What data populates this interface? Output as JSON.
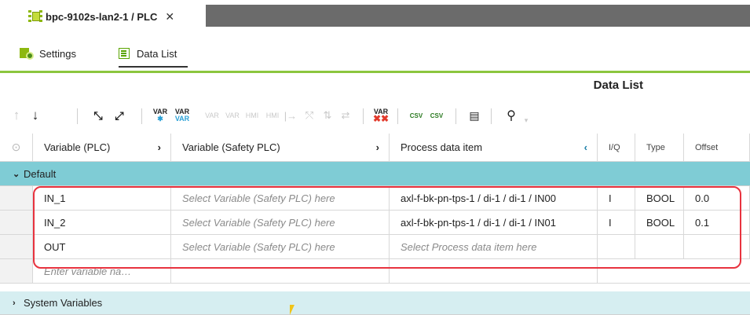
{
  "tab": {
    "title": "bpc-9102s-lan2-1 / PLC",
    "close_icon": "close-icon"
  },
  "subtabs": [
    {
      "label": "Settings",
      "icon": "settings-icon"
    },
    {
      "label": "Data List",
      "icon": "list-icon"
    }
  ],
  "panel_title": "Data List",
  "toolbar": {
    "buttons": [
      {
        "name": "move-up-icon",
        "glyph": "↑",
        "enabled": false
      },
      {
        "name": "move-down-icon",
        "glyph": "↓",
        "enabled": true
      },
      {
        "name": "collapse-all-icon",
        "glyph": "⤡",
        "enabled": true
      },
      {
        "name": "expand-all-icon",
        "glyph": "⤢",
        "enabled": true
      },
      {
        "name": "add-var-icon",
        "glyph": "VAR",
        "enabled": true
      },
      {
        "name": "add-var-group-icon",
        "glyph": "VAR",
        "enabled": true
      },
      {
        "name": "edit-var-icon",
        "glyph": "VAR",
        "enabled": false
      },
      {
        "name": "delete-var-icon",
        "glyph": "VAR",
        "enabled": false
      },
      {
        "name": "hmi-icon",
        "glyph": "HMI",
        "enabled": false
      },
      {
        "name": "hmi-delete-icon",
        "glyph": "HMI",
        "enabled": false
      },
      {
        "name": "link-icon",
        "glyph": "|→",
        "enabled": false
      },
      {
        "name": "unlink-icon",
        "glyph": "⤲",
        "enabled": false
      },
      {
        "name": "map-icon",
        "glyph": "⇅",
        "enabled": false
      },
      {
        "name": "swap-icon",
        "glyph": "⇄",
        "enabled": false
      },
      {
        "name": "delete-all-var-icon",
        "glyph": "VAR",
        "enabled": true
      },
      {
        "name": "import-csv-icon",
        "glyph": "CSV",
        "enabled": true
      },
      {
        "name": "export-csv-icon",
        "glyph": "CSV",
        "enabled": true
      },
      {
        "name": "table-view-icon",
        "glyph": "▤",
        "enabled": true
      },
      {
        "name": "search-icon",
        "glyph": "⚲",
        "enabled": true
      }
    ]
  },
  "columns": {
    "variable_plc": "Variable (PLC)",
    "variable_safety": "Variable (Safety PLC)",
    "process_item": "Process data item",
    "iq": "I/Q",
    "type": "Type",
    "offset": "Offset"
  },
  "groups": {
    "default": "Default",
    "system": "System Variables"
  },
  "rows": [
    {
      "plc": "IN_1",
      "safety": "Select Variable (Safety PLC) here",
      "item": "axl-f-bk-pn-tps-1 / di-1 / di-1 / IN00",
      "iq": "I",
      "type": "BOOL",
      "offset": "0.0"
    },
    {
      "plc": "IN_2",
      "safety": "Select Variable (Safety PLC) here",
      "item": "axl-f-bk-pn-tps-1 / di-1 / di-1 / IN01",
      "iq": "I",
      "type": "BOOL",
      "offset": "0.1"
    },
    {
      "plc": "OUT",
      "safety": "Select Variable (Safety PLC) here",
      "item": "Select Process data item here",
      "iq": "",
      "type": "",
      "offset": ""
    }
  ],
  "new_row_placeholder": "Enter variable na…"
}
